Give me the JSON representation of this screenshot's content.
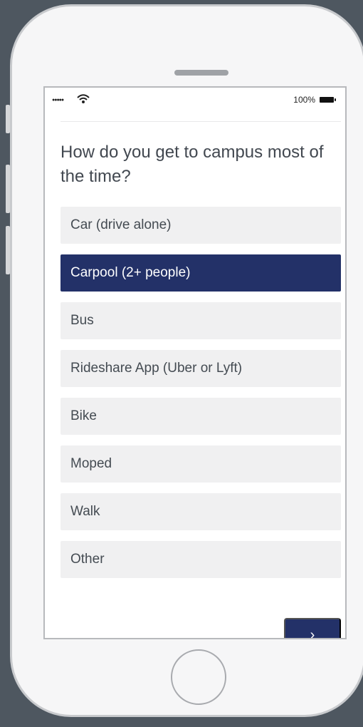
{
  "status_bar": {
    "signal_dots": "●●●●●",
    "wifi_icon": "wifi-icon",
    "battery_percent": "100%",
    "battery_icon": "battery-icon"
  },
  "question": "How do you get to campus most of the time?",
  "options": [
    {
      "label": "Car (drive alone)",
      "selected": false
    },
    {
      "label": "Carpool (2+ people)",
      "selected": true
    },
    {
      "label": "Bus",
      "selected": false
    },
    {
      "label": "Rideshare App (Uber or Lyft)",
      "selected": false
    },
    {
      "label": "Bike",
      "selected": false
    },
    {
      "label": "Moped",
      "selected": false
    },
    {
      "label": "Walk",
      "selected": false
    },
    {
      "label": "Other",
      "selected": false
    }
  ],
  "next_button": {
    "icon": "chevron-right-icon",
    "glyph": "›"
  },
  "colors": {
    "background": "#4e5760",
    "phone": "#f6f6f7",
    "screen": "#ffffff",
    "option_background": "#f0f0f1",
    "selected_option": "#233168",
    "question_text": "#424850"
  }
}
